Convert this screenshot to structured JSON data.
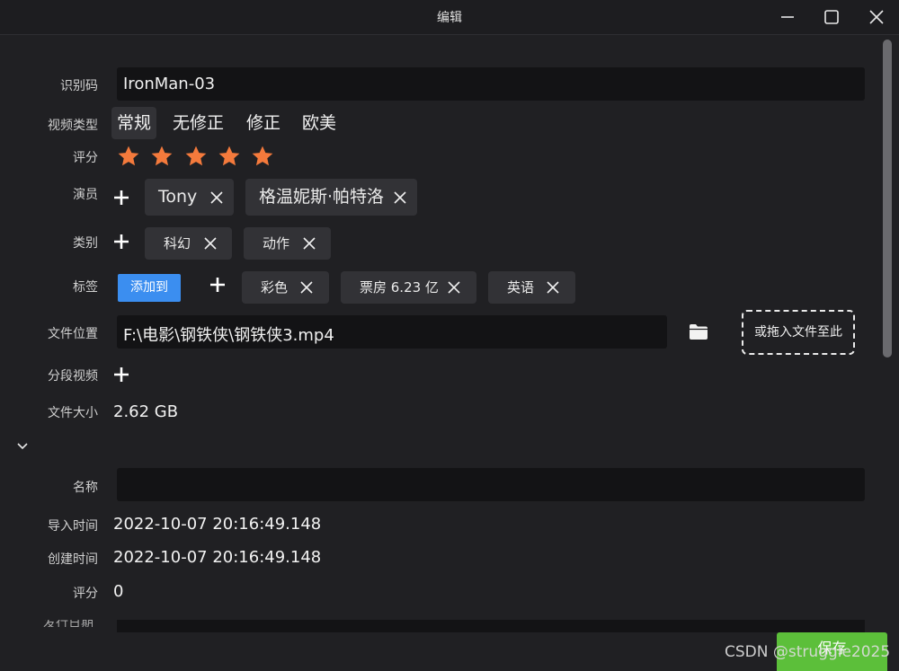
{
  "window": {
    "title": "编辑"
  },
  "labels": {
    "id_code": "识别码",
    "video_type": "视频类型",
    "rating": "评分",
    "actors": "演员",
    "category": "类别",
    "tags": "标签",
    "file_location": "文件位置",
    "segment_video": "分段视频",
    "file_size": "文件大小",
    "name": "名称",
    "import_time": "导入时间",
    "create_time": "创建时间",
    "rating2": "评分",
    "release_date_partial": "发行日期"
  },
  "fields": {
    "id_code": "IronMan-03",
    "file_path": "F:\\电影\\钢铁侠\\钢铁侠3.mp4",
    "file_size": "2.62 GB",
    "name": "",
    "import_time": "2022-10-07 20:16:49.148",
    "create_time": "2022-10-07 20:16:49.148",
    "rating2": "0"
  },
  "video_types": [
    "常规",
    "无修正",
    "修正",
    "欧美"
  ],
  "video_type_selected": "常规",
  "rating": {
    "value": 5,
    "max": 5,
    "color": "#f47a3c"
  },
  "actors": [
    "Tony",
    "格温妮斯·帕特洛"
  ],
  "categories": [
    "科幻",
    "动作"
  ],
  "tags": {
    "add_to_label": "添加到",
    "items": [
      "彩色",
      "票房 6.23 亿",
      "英语"
    ]
  },
  "dropzone_label": "或拖入文件至此",
  "save_label": "保存",
  "watermark": "CSDN @struggle2025",
  "colors": {
    "accent_blue": "#3b8ef0",
    "save_green": "#5cbf3a",
    "star": "#f47a3c"
  }
}
